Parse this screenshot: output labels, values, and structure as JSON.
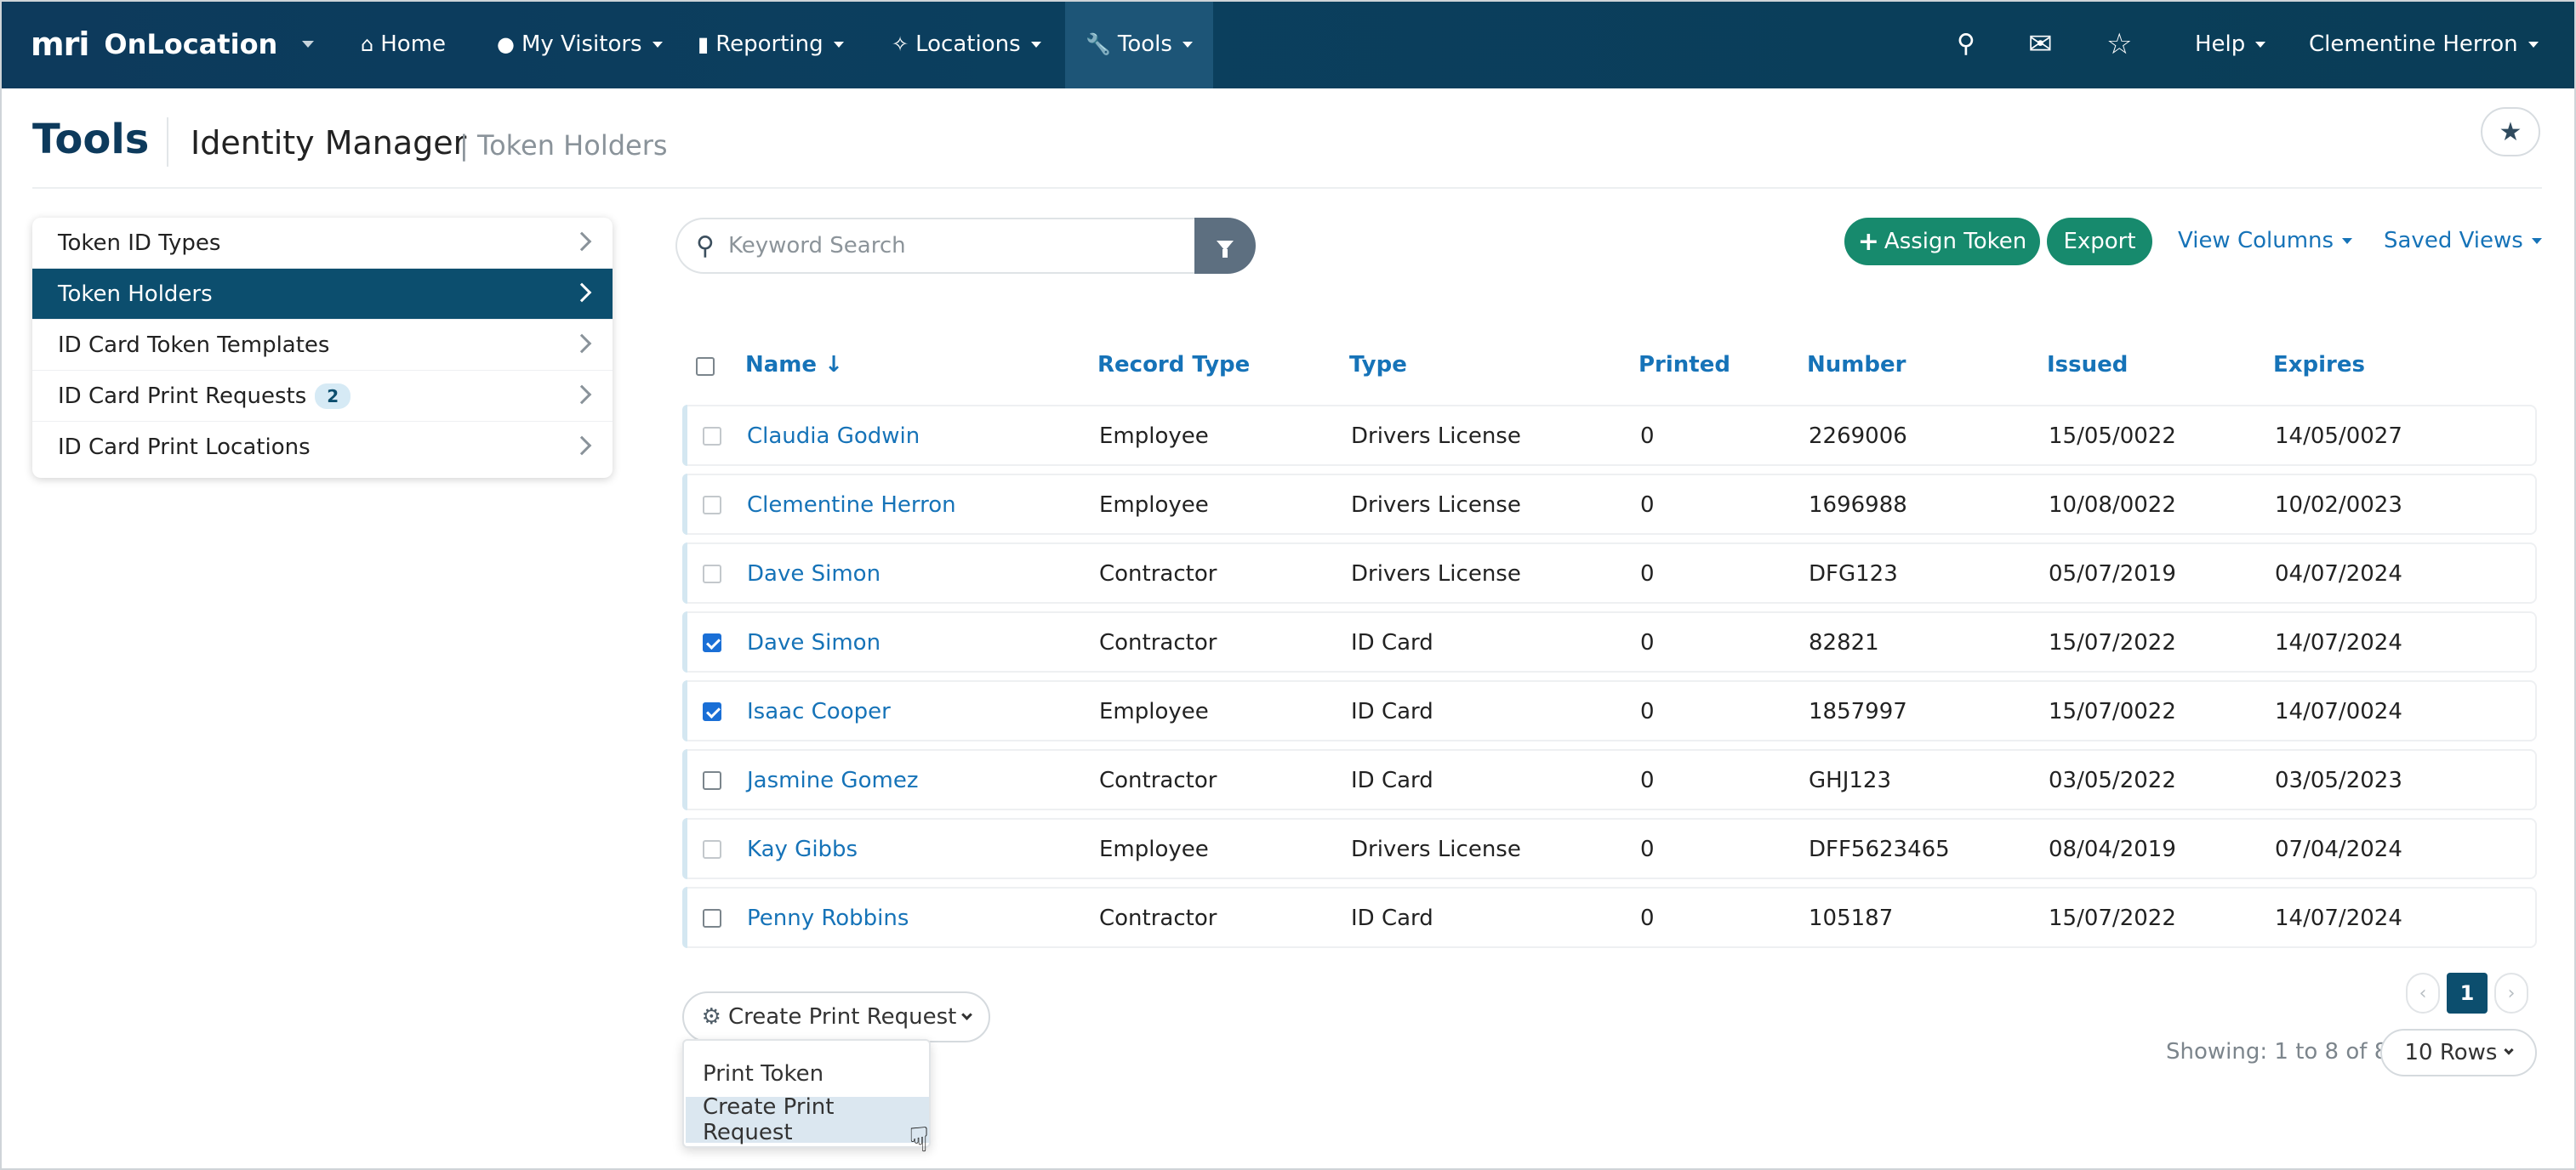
{
  "navbar": {
    "brand_mark": "mri",
    "brand_name": "OnLocation",
    "items": [
      {
        "label": "Home",
        "icon": "home-icon"
      },
      {
        "label": "My Visitors",
        "icon": "user-icon"
      },
      {
        "label": "Reporting",
        "icon": "bar-chart-icon"
      },
      {
        "label": "Locations",
        "icon": "network-icon"
      },
      {
        "label": "Tools",
        "icon": "wrench-icon"
      }
    ],
    "help": "Help",
    "user": "Clementine Herron"
  },
  "header": {
    "title": "Tools",
    "subtitle": "Identity Manager",
    "crumb": "| Token Holders"
  },
  "sidebar": {
    "items": [
      {
        "label": "Token ID Types"
      },
      {
        "label": "Token Holders"
      },
      {
        "label": "ID Card Token Templates"
      },
      {
        "label": "ID Card Print Requests",
        "badge": "2"
      },
      {
        "label": "ID Card Print Locations"
      }
    ]
  },
  "search": {
    "placeholder": "Keyword Search"
  },
  "toolbar": {
    "assign_label": "Assign Token",
    "export_label": "Export",
    "view_columns": "View Columns",
    "saved_views": "Saved Views"
  },
  "table": {
    "headers": [
      "Name ↓",
      "Record Type",
      "Type",
      "Printed",
      "Number",
      "Issued",
      "Expires"
    ],
    "rows": [
      {
        "name": "Claudia Godwin",
        "record_type": "Employee",
        "type": "Drivers License",
        "printed": "0",
        "number": "2269006",
        "issued": "15/05/0022",
        "expires": "14/05/0027",
        "checked": false
      },
      {
        "name": "Clementine Herron",
        "record_type": "Employee",
        "type": "Drivers License",
        "printed": "0",
        "number": "1696988",
        "issued": "10/08/0022",
        "expires": "10/02/0023",
        "checked": false
      },
      {
        "name": "Dave Simon",
        "record_type": "Contractor",
        "type": "Drivers License",
        "printed": "0",
        "number": "DFG123",
        "issued": "05/07/2019",
        "expires": "04/07/2024",
        "checked": false
      },
      {
        "name": "Dave Simon",
        "record_type": "Contractor",
        "type": "ID Card",
        "printed": "0",
        "number": "82821",
        "issued": "15/07/2022",
        "expires": "14/07/2024",
        "checked": true
      },
      {
        "name": "Isaac Cooper",
        "record_type": "Employee",
        "type": "ID Card",
        "printed": "0",
        "number": "1857997",
        "issued": "15/07/0022",
        "expires": "14/07/0024",
        "checked": true
      },
      {
        "name": "Jasmine Gomez",
        "record_type": "Contractor",
        "type": "ID Card",
        "printed": "0",
        "number": "GHJ123",
        "issued": "03/05/2022",
        "expires": "03/05/2023",
        "checked": false
      },
      {
        "name": "Kay Gibbs",
        "record_type": "Employee",
        "type": "Drivers License",
        "printed": "0",
        "number": "DFF5623465",
        "issued": "08/04/2019",
        "expires": "07/04/2024",
        "checked": false
      },
      {
        "name": "Penny Robbins",
        "record_type": "Contractor",
        "type": "ID Card",
        "printed": "0",
        "number": "105187",
        "issued": "15/07/2022",
        "expires": "14/07/2024",
        "checked": false
      }
    ]
  },
  "actions": {
    "dropdown_label": "Create Print Request",
    "menu": [
      "Print Token",
      "Create Print Request"
    ]
  },
  "pagination": {
    "page": "1",
    "showing": "Showing: 1 to 8 of 8",
    "rows_label": "10 Rows"
  },
  "colors": {
    "navbar": "#0d3a5c",
    "accent": "#1673b8",
    "green": "#178a6d",
    "active": "#0c4e6e"
  }
}
